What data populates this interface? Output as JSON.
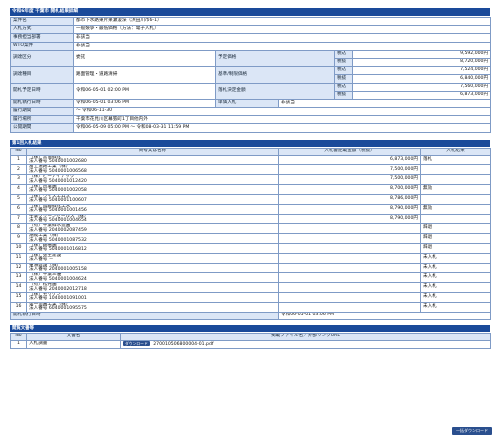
{
  "title": "令和6年度 千葉市 開札結果詳細",
  "info": {
    "case_name_label": "案件名",
    "case_name": "都市下水路東片果瀬浚渫（浜田川市6-1）",
    "method_label": "入札方式",
    "method": "一般競争・最低価格（方法：電子入札）",
    "dept_label": "事務担当部署",
    "dept": "非該当",
    "wto_label": "WTO案件",
    "wto": "非該当",
    "category_label": "調達区分",
    "category": "委託",
    "kind_label": "調達種目",
    "kind": "路面管理・道路清掃",
    "open_date_label": "開札予定日時",
    "open_date": "令和06-05-01 02:00 PM",
    "est_label": "予定価格",
    "est_pre": "税込",
    "est_pre_v": "9,592,000円",
    "est_ex": "税抜",
    "est_ex_v": "8,720,000円",
    "base_label": "基準/制限価格",
    "base_pre": "税込",
    "base_pre_v": "7,524,000円",
    "base_ex": "税抜",
    "base_ex_v": "6,840,000円",
    "award_label": "落札決定金額",
    "award_pre": "税込",
    "award_pre_v": "7,560,000円",
    "award_ex": "税抜",
    "award_ex_v": "6,873,000円",
    "exec_label": "開札執行日時",
    "exec_date": "令和06-05-01 03:06 PM",
    "single_label": "単価入札",
    "single": "非該当",
    "period_label": "履行期間",
    "period": "～ 令和06-11-30",
    "place_label": "履行場所",
    "place": "千葉市花見川区幕張町1丁目他内外",
    "public_label": "公開期間",
    "public": "令和06-05-09 05:00 PM ～ 令和08-03-31 11:59 PM"
  },
  "bids": {
    "section_title": "第1回入札結果",
    "col_no": "No",
    "col_name": "商号又は名称",
    "col_amount": "入札書記載金額（税抜）",
    "col_result": "入札結果",
    "rows": [
      {
        "no": "1",
        "name": "（株）三協緑化",
        "corp": "法人番号 5040001002680",
        "amount": "6,873,000円",
        "result": "落札"
      },
      {
        "no": "2",
        "name": "富士道路工業（株）",
        "corp": "法人番号 5040001006568",
        "amount": "7,500,000円",
        "result": ""
      },
      {
        "no": "3",
        "name": "（株）ビーアイテック",
        "corp": "法人番号 5040001012420",
        "amount": "7,500,000円",
        "result": ""
      },
      {
        "no": "4",
        "name": "（株）京葉園",
        "corp": "法人番号 5040001002058",
        "amount": "8,700,000円",
        "result": "無効"
      },
      {
        "no": "5",
        "name": "（株）ウイズエムズ",
        "corp": "法人番号 5040001100607",
        "amount": "8,786,000円",
        "result": ""
      },
      {
        "no": "6",
        "name": "（株）加藤緑化工木",
        "corp": "法人番号 5040001001456",
        "amount": "8,790,000円",
        "result": "無効"
      },
      {
        "no": "7",
        "name": "千葉グリーンセールス（株）",
        "corp": "法人番号 5040001004654",
        "amount": "8,790,000円",
        "result": ""
      },
      {
        "no": "8",
        "name": "（有）千葉緑水造園",
        "corp": "法人番号 2040002087459",
        "amount": "",
        "result": "辞退"
      },
      {
        "no": "9",
        "name": "潮成工業（株）",
        "corp": "法人番号 5040001087532",
        "amount": "",
        "result": "辞退"
      },
      {
        "no": "10",
        "name": "（株）錦樹園",
        "corp": "法人番号 5040001016812",
        "amount": "",
        "result": "辞退"
      },
      {
        "no": "11",
        "name": "（株）弥生建設",
        "corp": "法人番号 －",
        "amount": "",
        "result": "未入札"
      },
      {
        "no": "12",
        "name": "東海建設（株）",
        "corp": "法人番号 2040001005158",
        "amount": "",
        "result": "未入札"
      },
      {
        "no": "13",
        "name": "（株）千葉三優",
        "corp": "法人番号 5040001004624",
        "amount": "",
        "result": "未入札"
      },
      {
        "no": "14",
        "name": "（有）松光園",
        "corp": "法人番号 2040002012718",
        "amount": "",
        "result": "未入札"
      },
      {
        "no": "15",
        "name": "（株）モリケン",
        "corp": "法人番号 1040001091001",
        "amount": "",
        "result": "未入札"
      },
      {
        "no": "16",
        "name": "第一造園工業（株）",
        "corp": "法人番号 6040001095575",
        "amount": "",
        "result": "未入札"
      }
    ],
    "exec_label": "開札執行日時",
    "exec_date": "令和06-05-01 03:06 PM"
  },
  "docs": {
    "section_title": "閲覧文書等",
    "col_no": "No",
    "col_name": "文書名",
    "col_file": "掲載ファイル名／外部リンクURL",
    "rows": [
      {
        "no": "1",
        "name": "入札調書",
        "btn": "ダウンロード",
        "file": "270010506800004-01.pdf"
      }
    ],
    "download_all": "一括ダウンロード"
  }
}
